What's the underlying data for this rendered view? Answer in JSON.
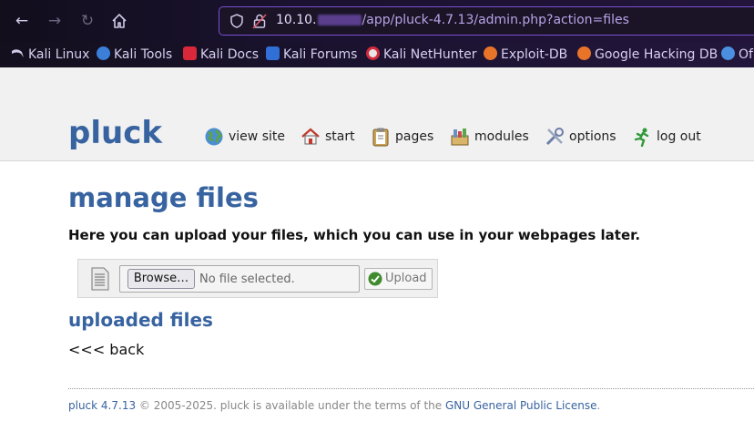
{
  "browser": {
    "url_host": "10.10.",
    "url_path": "/app/pluck-4.7.13/admin.php?action=files",
    "bookmarks": [
      {
        "label": "Kali Linux",
        "icon": "kali-dragon-icon"
      },
      {
        "label": "Kali Tools",
        "icon": "kali-tools-icon"
      },
      {
        "label": "Kali Docs",
        "icon": "kali-docs-icon"
      },
      {
        "label": "Kali Forums",
        "icon": "kali-forums-icon"
      },
      {
        "label": "Kali NetHunter",
        "icon": "kali-nethunter-icon"
      },
      {
        "label": "Exploit-DB",
        "icon": "exploit-db-icon"
      },
      {
        "label": "Google Hacking DB",
        "icon": "ghdb-icon"
      },
      {
        "label": "Of",
        "icon": "offsec-icon"
      }
    ]
  },
  "header": {
    "logo": "pluck",
    "menu": [
      {
        "label": "view site",
        "icon": "globe-icon"
      },
      {
        "label": "start",
        "icon": "home-icon"
      },
      {
        "label": "pages",
        "icon": "clipboard-icon"
      },
      {
        "label": "modules",
        "icon": "modules-icon"
      },
      {
        "label": "options",
        "icon": "tools-icon"
      },
      {
        "label": "log out",
        "icon": "running-man-icon"
      }
    ]
  },
  "main": {
    "title": "manage files",
    "intro": "Here you can upload your files, which you can use in your webpages later.",
    "upload": {
      "browse_label": "Browse…",
      "file_status": "No file selected.",
      "upload_label": "Upload"
    },
    "uploaded_title": "uploaded files",
    "back_label": "<<< back"
  },
  "footer": {
    "version_link": "pluck 4.7.13",
    "text": " © 2005-2025. pluck is available under the terms of the ",
    "license_link": "GNU General Public License",
    "suffix": "."
  },
  "colors": {
    "accent": "#3763a0",
    "browser_bg": "#14101f",
    "url_border": "#7b4fd1"
  }
}
